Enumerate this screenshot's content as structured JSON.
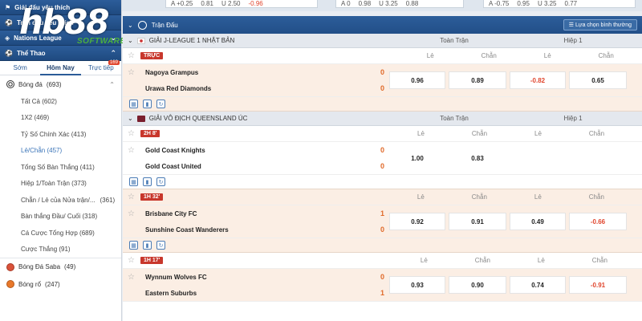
{
  "top_strip": {
    "card1": {
      "a": "A +0.25",
      "b": "0.81",
      "c": "U 2.50",
      "d": "-0.96"
    },
    "card2": {
      "a": "A 0",
      "b": "0.98",
      "c": "U 3.25",
      "d": "0.88"
    },
    "card3": {
      "a": "A -0.75",
      "b": "0.95",
      "c": "U 3.25",
      "d": "0.77"
    }
  },
  "logo": {
    "main": "hb88",
    "sub": "SOFTWARE"
  },
  "sidebar": {
    "headers": [
      {
        "label": "Giải đấu yêu thích"
      },
      {
        "label": "Trận đấu yêu thích"
      },
      {
        "label": "Nations League"
      },
      {
        "label": "Thể Thao"
      }
    ],
    "time_tabs": {
      "early": "Sớm",
      "today": "Hôm Nay",
      "live": "Trực tiếp",
      "live_count": "169"
    },
    "sports": [
      {
        "label": "Bóng đá",
        "count": "(693)"
      },
      {
        "label": "Bóng Đá Saba",
        "count": "(49)"
      },
      {
        "label": "Bóng rổ",
        "count": "(247)"
      }
    ],
    "sub_items": [
      "Tất Cả (602)",
      "1X2 (469)",
      "Tỷ Số Chính Xác (413)",
      "Lẻ/Chẵn (457)",
      "Tổng Số Bàn Thắng (411)",
      "Hiệp 1/Toàn Trận (373)",
      "Chẵn / Lẻ của Nửa trận/...",
      "Bàn thắng Đầu/ Cuối (318)",
      "Cá Cược Tổng Hợp (689)",
      "Cược Thắng (91)"
    ],
    "sub_item_7_count": "(361)"
  },
  "main": {
    "header_title": "Trận Đấu",
    "filter_label": "Lựa chọn bình thường",
    "col_full": "Toàn Trận",
    "col_half": "Hiệp 1",
    "col_le": "Lẻ",
    "col_chan": "Chẵn",
    "leagues": [
      {
        "name": "GIẢI J-LEAGUE 1 NHẬT BẢN"
      },
      {
        "name": "GIẢI VÔ ĐỊCH QUEENSLAND ÚC"
      }
    ],
    "matches": [
      {
        "status": "TRỰC",
        "home": "Nagoya Grampus",
        "away": "Urawa Red Diamonds",
        "home_score": "0",
        "away_score": "0",
        "ft_le": "0.96",
        "ft_chan": "0.89",
        "h1_le": "-0.82",
        "h1_chan": "0.65"
      },
      {
        "status": "2H 8'",
        "home": "Gold Coast Knights",
        "away": "Gold Coast United",
        "home_score": "0",
        "away_score": "0",
        "ft_le": "1.00",
        "ft_chan": "0.83",
        "h1_le": "",
        "h1_chan": ""
      },
      {
        "status": "1H 32'",
        "home": "Brisbane City FC",
        "away": "Sunshine Coast Wanderers",
        "home_score": "1",
        "away_score": "0",
        "ft_le": "0.92",
        "ft_chan": "0.91",
        "h1_le": "0.49",
        "h1_chan": "-0.66"
      },
      {
        "status": "1H 17'",
        "home": "Wynnum Wolves FC",
        "away": "Eastern Suburbs",
        "home_score": "0",
        "away_score": "1",
        "ft_le": "0.93",
        "ft_chan": "0.90",
        "h1_le": "0.74",
        "h1_chan": "-0.91"
      }
    ]
  },
  "colors": {
    "header_blue": "#2c5d9a",
    "negative": "#e0452d",
    "score": "#e06a2a",
    "match_bg": "#fbeee4"
  }
}
